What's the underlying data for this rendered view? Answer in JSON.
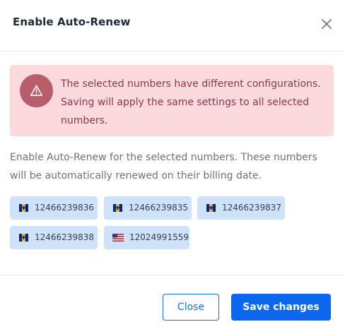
{
  "modal": {
    "title": "Enable Auto-Renew",
    "close_icon": "close-icon"
  },
  "alert": {
    "icon": "warning-triangle-icon",
    "message": "The selected numbers have different configurations. Saving will apply the same settings to all selected numbers."
  },
  "description": "Enable Auto-Renew for the selected numbers. These numbers will be automatically renewed on their billing date.",
  "numbers": [
    {
      "number": "12466239836",
      "flag": "barbados-flag-icon"
    },
    {
      "number": "12466239835",
      "flag": "barbados-flag-icon"
    },
    {
      "number": "12466239837",
      "flag": "barbados-flag-icon"
    },
    {
      "number": "12466239838",
      "flag": "barbados-flag-icon"
    },
    {
      "number": "12024991559",
      "flag": "us-flag-icon"
    }
  ],
  "footer": {
    "close_label": "Close",
    "save_label": "Save changes"
  },
  "colors": {
    "primary": "#0b66f0",
    "alert_bg": "#fcd9dd",
    "alert_text": "#8b3a48",
    "alert_icon_bg": "#b85d6a",
    "chip_bg": "#cfe2fb"
  }
}
